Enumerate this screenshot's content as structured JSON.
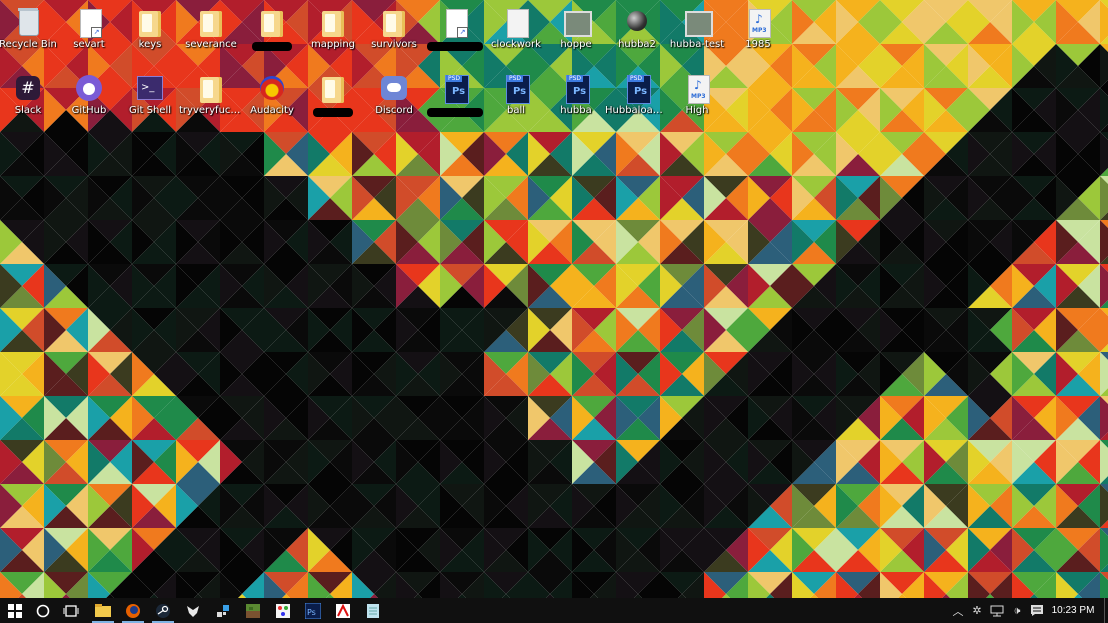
{
  "desktop": {
    "icons": [
      {
        "label": "Recycle Bin",
        "icon": "recycle-bin-icon"
      },
      {
        "label": "sevart",
        "icon": "file-shortcut-icon"
      },
      {
        "label": "keys",
        "icon": "folder-icon"
      },
      {
        "label": "severance",
        "icon": "folder-icon"
      },
      {
        "label": "",
        "icon": "folder-icon",
        "redacted": true
      },
      {
        "label": "mapping",
        "icon": "folder-icon"
      },
      {
        "label": "survivors",
        "icon": "folder-icon"
      },
      {
        "label": "",
        "icon": "file-shortcut-icon",
        "redacted": true
      },
      {
        "label": "clockwork",
        "icon": "file-icon"
      },
      {
        "label": "hoppe",
        "icon": "image-icon"
      },
      {
        "label": "hubba2",
        "icon": "ball-icon"
      },
      {
        "label": "hubba-test",
        "icon": "image-icon"
      },
      {
        "label": "1985",
        "icon": "mp3-file-icon"
      },
      {
        "label": "Slack",
        "icon": "slack-icon"
      },
      {
        "label": "GitHub",
        "icon": "github-icon"
      },
      {
        "label": "Git Shell",
        "icon": "git-shell-icon"
      },
      {
        "label": "tryveryfuck...",
        "icon": "folder-icon"
      },
      {
        "label": "Audacity",
        "icon": "audacity-icon"
      },
      {
        "label": "",
        "icon": "folder-icon",
        "redacted": true
      },
      {
        "label": "Discord",
        "icon": "discord-icon"
      },
      {
        "label": "",
        "icon": "psd-file-icon",
        "redacted": true
      },
      {
        "label": "ball",
        "icon": "psd-file-icon"
      },
      {
        "label": "hubba",
        "icon": "psd-file-icon"
      },
      {
        "label": "Hubbaloader",
        "icon": "psd-file-icon"
      },
      {
        "label": "High",
        "icon": "mp3-file-icon"
      }
    ]
  },
  "taskbar": {
    "start": {
      "icon": "windows-start-icon"
    },
    "search": {
      "icon": "cortana-circle-icon"
    },
    "task_view": {
      "icon": "task-view-icon"
    },
    "pinned": [
      {
        "name": "file-explorer",
        "icon": "folder-icon",
        "active": true
      },
      {
        "name": "firefox",
        "icon": "firefox-icon",
        "active": true
      },
      {
        "name": "steam",
        "icon": "steam-icon",
        "active": true
      },
      {
        "name": "app-dragon",
        "icon": "dragon-icon",
        "active": false
      },
      {
        "name": "app-tool",
        "icon": "tool-icon",
        "active": false
      },
      {
        "name": "app-minecraft",
        "icon": "minecraft-icon",
        "active": false
      },
      {
        "name": "app-paint",
        "icon": "paint-icon",
        "active": false
      },
      {
        "name": "photoshop",
        "icon": "photoshop-icon",
        "active": false
      },
      {
        "name": "acrobat",
        "icon": "acrobat-icon",
        "active": false
      },
      {
        "name": "app-notes",
        "icon": "notes-icon",
        "active": false
      }
    ],
    "tray": {
      "icons": [
        "chevron-up-icon",
        "settings-gear-icon",
        "network-icon",
        "volume-icon",
        "action-center-icon"
      ],
      "time": "10:23 PM"
    }
  }
}
